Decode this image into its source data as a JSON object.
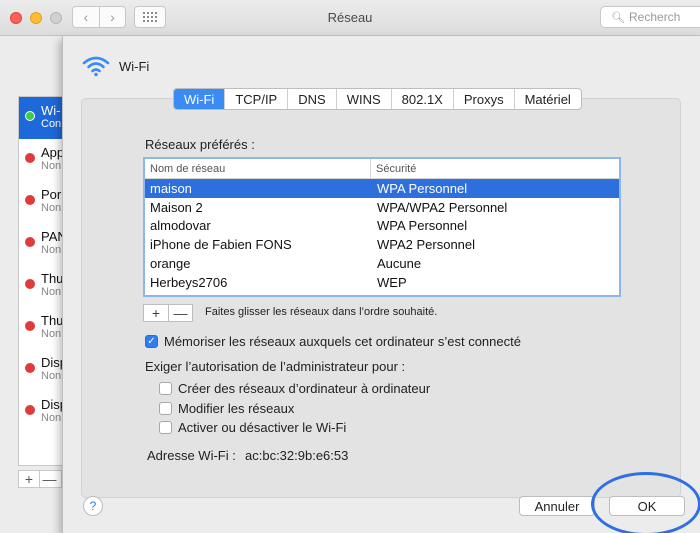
{
  "window": {
    "title": "Réseau",
    "search_placeholder": "Recherch"
  },
  "sidebar": {
    "items": [
      {
        "name": "Wi-",
        "status": "Con",
        "state": "connected"
      },
      {
        "name": "App",
        "status": "Non",
        "state": "off"
      },
      {
        "name": "Por",
        "status": "Non",
        "state": "off"
      },
      {
        "name": "PAN",
        "status": "Non",
        "state": "off"
      },
      {
        "name": "Thu",
        "status": "Non",
        "state": "off"
      },
      {
        "name": "Thu",
        "status": "Non",
        "state": "off"
      },
      {
        "name": "Disp",
        "status": "Non",
        "state": "off"
      },
      {
        "name": "Disp",
        "status": "Non",
        "state": "off"
      }
    ],
    "add_label": "+",
    "remove_label": "—"
  },
  "sheet": {
    "title": "Wi-Fi",
    "tabs": [
      {
        "label": "Wi-Fi",
        "active": true
      },
      {
        "label": "TCP/IP",
        "active": false
      },
      {
        "label": "DNS",
        "active": false
      },
      {
        "label": "WINS",
        "active": false
      },
      {
        "label": "802.1X",
        "active": false
      },
      {
        "label": "Proxys",
        "active": false
      },
      {
        "label": "Matériel",
        "active": false
      }
    ],
    "preferred_label": "Réseaux préférés :",
    "table": {
      "headers": [
        "Nom de réseau",
        "Sécurité"
      ],
      "rows": [
        {
          "name": "maison",
          "security": "WPA Personnel",
          "selected": true
        },
        {
          "name": "Maison 2",
          "security": "WPA/WPA2 Personnel",
          "selected": false
        },
        {
          "name": "almodovar",
          "security": "WPA Personnel",
          "selected": false
        },
        {
          "name": "iPhone de Fabien FONS",
          "security": "WPA2 Personnel",
          "selected": false
        },
        {
          "name": "orange",
          "security": "Aucune",
          "selected": false
        },
        {
          "name": "Herbeys2706",
          "security": "WEP",
          "selected": false
        }
      ]
    },
    "add_label": "+",
    "remove_label": "—",
    "drag_hint": "Faites glisser les réseaux dans l’ordre souhaité.",
    "remember_checkbox": {
      "label": "Mémoriser les réseaux auxquels cet ordinateur s’est connecté",
      "checked": true
    },
    "admin_label": "Exiger l’autorisation de l’administrateur pour :",
    "admin_options": [
      {
        "label": "Créer des réseaux d’ordinateur à ordinateur",
        "checked": false
      },
      {
        "label": "Modifier les réseaux",
        "checked": false
      },
      {
        "label": "Activer ou désactiver le Wi-Fi",
        "checked": false
      }
    ],
    "address_label": "Adresse Wi-Fi :",
    "address_value": "ac:bc:32:9b:e6:53",
    "help_label": "?",
    "cancel_label": "Annuler",
    "ok_label": "OK"
  },
  "colors": {
    "accent": "#2d6fdc",
    "tab_active": "#3b8bf5",
    "highlight_ring": "#2f6fe3",
    "status_red": "#e03b3b",
    "status_green": "#3dcc4c"
  }
}
